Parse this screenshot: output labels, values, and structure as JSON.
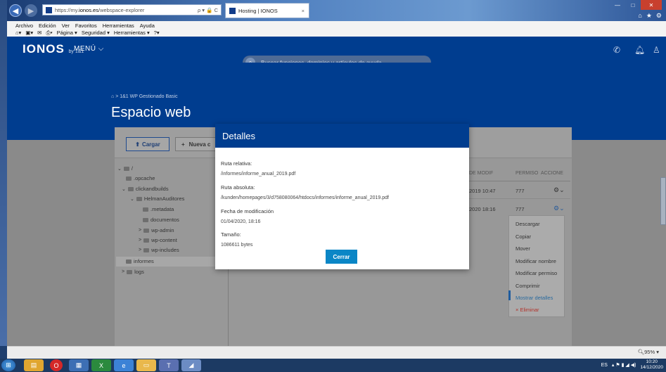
{
  "browser": {
    "url_prefix": "https://my.",
    "url_host": "ionos.es",
    "url_path": "/webspace-explorer",
    "addr_controls": "ρ ▾ 🔒 C",
    "tab_title": "Hosting | IONOS",
    "tab_close": "×",
    "win_min": "—",
    "win_max": "□",
    "win_close": "✕",
    "menu": [
      "Archivo",
      "Edición",
      "Ver",
      "Favoritos",
      "Herramientas",
      "Ayuda"
    ],
    "toolbar": [
      "Página ▾",
      "Seguridad ▾",
      "Herramientas ▾"
    ]
  },
  "header": {
    "logo": "IONOS",
    "logo_sub": "by 1&1",
    "menu_label": "MENÚ ⌵",
    "search_placeholder": "Buscar funciones, dominios y artículos de ayuda"
  },
  "hero": {
    "breadcrumb": "> 1&1 WP Gestionado Basic",
    "title": "Espacio web"
  },
  "toolbar": {
    "upload": "Cargar",
    "new": "Nueva c"
  },
  "tree": [
    {
      "label": "/",
      "chev": "⌄"
    },
    {
      "label": ".opcache",
      "chev": ""
    },
    {
      "label": "clickandbuilds",
      "chev": "⌄"
    },
    {
      "label": "HelmanAuditores",
      "chev": "⌄"
    },
    {
      "label": ".metadata",
      "chev": ""
    },
    {
      "label": "documentos",
      "chev": ""
    },
    {
      "label": "wp-admin",
      "chev": ">"
    },
    {
      "label": "wp-content",
      "chev": ">"
    },
    {
      "label": "wp-includes",
      "chev": ">"
    },
    {
      "label": "informes",
      "chev": ""
    },
    {
      "label": "logs",
      "chev": ">"
    }
  ],
  "table": {
    "columns": [
      "DE MODIF",
      "PERMISO",
      "ACCIONE"
    ],
    "rows": [
      {
        "date": "2019 10:47",
        "perm": "777"
      },
      {
        "date": "2020 18:16",
        "perm": "777"
      }
    ]
  },
  "context_menu": [
    "Descargar",
    "Copiar",
    "Mover",
    "Modificar nombre",
    "Modificar permiso",
    "Comprimir",
    "Mostrar detalles",
    "× Eliminar"
  ],
  "modal": {
    "title": "Detalles",
    "rel_label": "Ruta relativa:",
    "rel_value": "/informes/informe_anual_2019.pdf",
    "abs_label": "Ruta absoluta:",
    "abs_value": "/kunden/homepages/3/d758080064/htdocs/informes/informe_anual_2019.pdf",
    "date_label": "Fecha de modificación",
    "date_value": "01/04/2020, 18:16",
    "size_label": "Tamaño:",
    "size_value": "1086611 bytes",
    "close": "Cerrar"
  },
  "status": {
    "zoom": "95%"
  },
  "tray": {
    "lang": "ES",
    "time": "10:20",
    "date": "14/12/2020"
  },
  "colors": {
    "brand": "#003d8f",
    "button_primary": "#0a86c6"
  }
}
